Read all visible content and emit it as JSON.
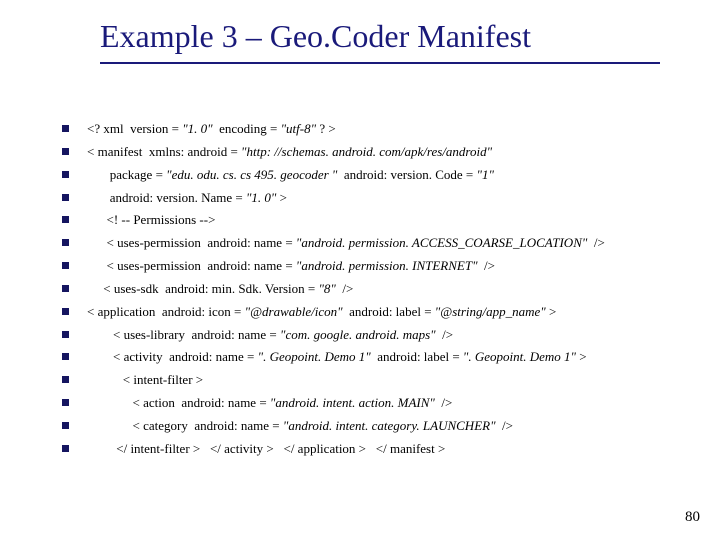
{
  "title": "Example 3 – Geo.Coder Manifest",
  "page_number": "80",
  "lines": [
    {
      "pre": "<? xml  version = ",
      "q": "\"1. 0\"",
      "mid": "  encoding = ",
      "q2": "\"utf-8\"",
      "post": " ? >"
    },
    {
      "pre": "< manifest  xmlns: android = ",
      "q": "\"http: //schemas. android. com/apk/res/android\"",
      "mid": "",
      "q2": "",
      "post": ""
    },
    {
      "pre": "       package = ",
      "q": "\"edu. odu. cs. cs 495. geocoder \"",
      "mid": "  android: version. Code = ",
      "q2": "\"1\"",
      "post": ""
    },
    {
      "pre": "       android: version. Name = ",
      "q": "\"1. 0\"",
      "mid": " >",
      "q2": "",
      "post": ""
    },
    {
      "pre": "      <! -- Permissions -->",
      "q": "",
      "mid": "",
      "q2": "",
      "post": ""
    },
    {
      "pre": "      < uses-permission  android: name = ",
      "q": "\"android. permission. ACCESS_COARSE_LOCATION\"",
      "mid": "  />",
      "q2": "",
      "post": ""
    },
    {
      "pre": "      < uses-permission  android: name = ",
      "q": "\"android. permission. INTERNET\"",
      "mid": "  />",
      "q2": "",
      "post": ""
    },
    {
      "pre": "     < uses-sdk  android: min. Sdk. Version = ",
      "q": "\"8\"",
      "mid": "  />",
      "q2": "",
      "post": ""
    },
    {
      "pre": "< application  android: icon = ",
      "q": "\"@drawable/icon\"",
      "mid": "  android: label = ",
      "q2": "\"@string/app_name\"",
      "post": " >"
    },
    {
      "pre": "        < uses-library  android: name = ",
      "q": "\"com. google. android. maps\"",
      "mid": "  />",
      "q2": "",
      "post": ""
    },
    {
      "pre": "        < activity  android: name = ",
      "q": "\". Geopoint. Demo 1\"",
      "mid": "  android: label = ",
      "q2": "\". Geopoint. Demo 1\"",
      "post": " >"
    },
    {
      "pre": "           < intent-filter >",
      "q": "",
      "mid": "",
      "q2": "",
      "post": ""
    },
    {
      "pre": "              < action  android: name = ",
      "q": "\"android. intent. action. MAIN\"",
      "mid": "  />",
      "q2": "",
      "post": ""
    },
    {
      "pre": "              < category  android: name = ",
      "q": "\"android. intent. category. LAUNCHER\"",
      "mid": "  />",
      "q2": "",
      "post": ""
    },
    {
      "pre": "         </ intent-filter >   </ activity >   </ application >   </ manifest >",
      "q": "",
      "mid": "",
      "q2": "",
      "post": ""
    }
  ]
}
